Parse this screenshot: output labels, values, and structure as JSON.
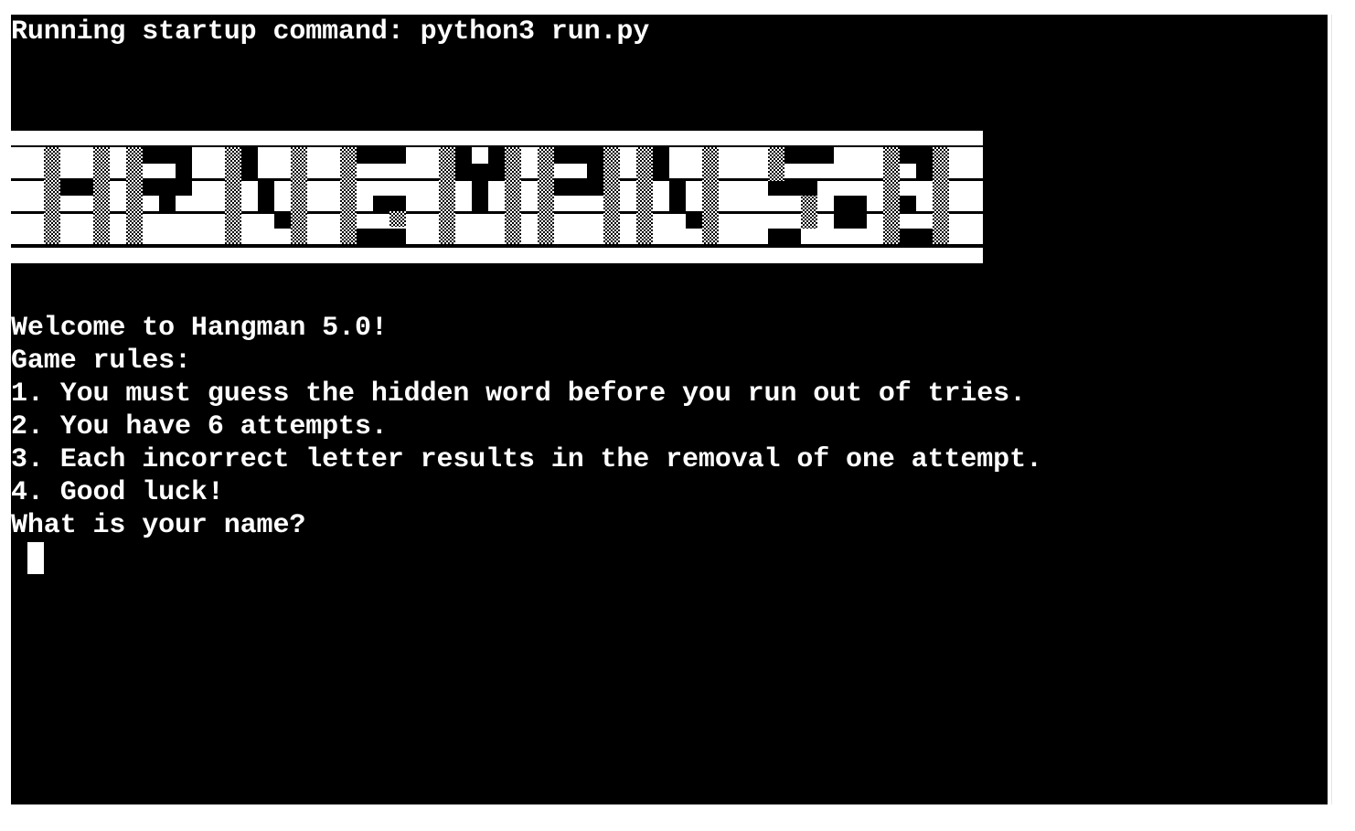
{
  "terminal": {
    "startup_line": "Running startup command: python3 run.py",
    "banner_text": "HANGMAN 5.0",
    "lines": [
      "Welcome to Hangman 5.0!",
      "Game rules:",
      "1. You must guess the hidden word before you run out of tries.",
      "2. You have 6 attempts.",
      "3. Each incorrect letter results in the removal of one attempt.",
      "4. Good luck!",
      "What is your name?"
    ],
    "input_value": ""
  },
  "colors": {
    "background": "#000000",
    "foreground": "#ffffff"
  }
}
